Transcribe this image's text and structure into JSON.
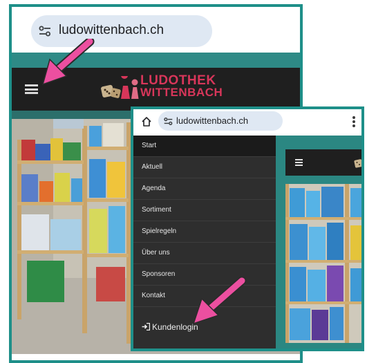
{
  "back_screenshot": {
    "url": "ludowittenbach.ch",
    "site_logo": {
      "line1": "LUDOTHEK",
      "line2": "WITTENBACH"
    }
  },
  "front_screenshot": {
    "url": "ludowittenbach.ch",
    "menu": {
      "items": [
        {
          "label": "Start",
          "active": true
        },
        {
          "label": "Aktuell"
        },
        {
          "label": "Agenda"
        },
        {
          "label": "Sortiment"
        },
        {
          "label": "Spielregeln"
        },
        {
          "label": "Über uns"
        },
        {
          "label": "Sponsoren"
        },
        {
          "label": "Kontakt"
        }
      ],
      "login_label": "Kundenlogin"
    }
  },
  "colors": {
    "border_teal": "#1e8f89",
    "header_dark": "#1f1f1f",
    "menu_dark": "#2e2e2e",
    "logo_red": "#d8365a",
    "arrow_pink": "#ec4fa0"
  },
  "icons": [
    "site-settings-icon",
    "home-icon",
    "more-vert-icon",
    "hamburger-menu-icon",
    "login-door-icon",
    "ludothek-logo-icon"
  ]
}
